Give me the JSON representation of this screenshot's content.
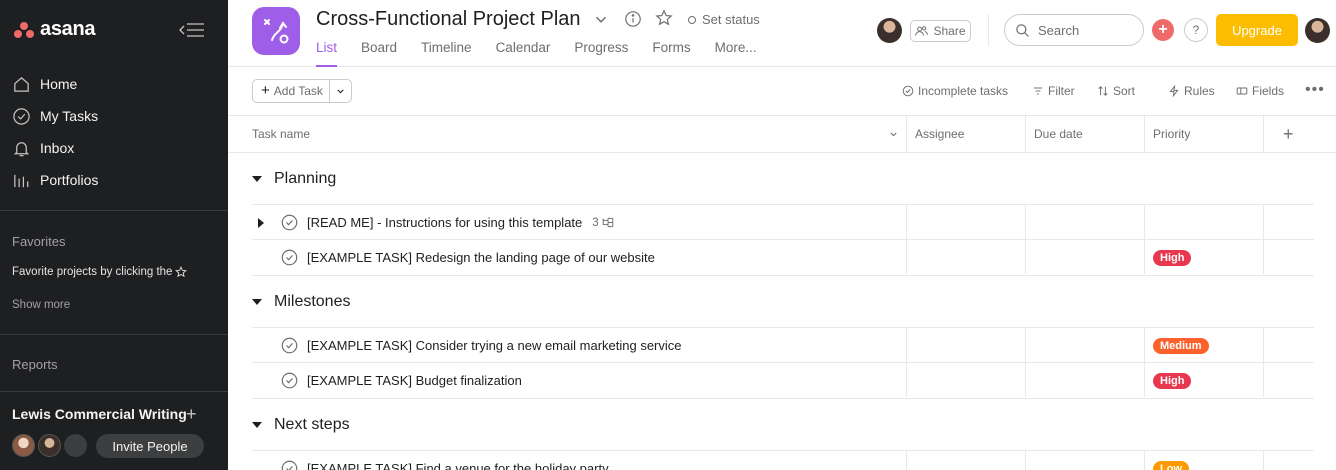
{
  "sidebar": {
    "brand": "asana",
    "nav": [
      {
        "label": "Home",
        "icon": "home-icon"
      },
      {
        "label": "My Tasks",
        "icon": "check-circle-icon"
      },
      {
        "label": "Inbox",
        "icon": "bell-icon"
      },
      {
        "label": "Portfolios",
        "icon": "bar-chart-icon"
      }
    ],
    "favorites_title": "Favorites",
    "favorites_hint": "Favorite projects by clicking the",
    "show_more": "Show more",
    "reports_title": "Reports",
    "team_name": "Lewis Commercial Writing",
    "invite_label": "Invite People"
  },
  "header": {
    "project_title": "Cross-Functional Project Plan",
    "set_status": "Set status",
    "tabs": [
      "List",
      "Board",
      "Timeline",
      "Calendar",
      "Progress",
      "Forms",
      "More..."
    ],
    "active_tab": "List",
    "share_label": "Share",
    "search_placeholder": "Search",
    "help_label": "?",
    "upgrade_label": "Upgrade",
    "accent_color": "#9e5ee8",
    "upgrade_color": "#fcbd01"
  },
  "toolbar": {
    "add_task": "Add Task",
    "incomplete": "Incomplete tasks",
    "filter": "Filter",
    "sort": "Sort",
    "rules": "Rules",
    "fields": "Fields"
  },
  "table": {
    "columns": [
      "Task name",
      "Assignee",
      "Due date",
      "Priority"
    ],
    "sections": [
      {
        "name": "Planning",
        "tasks": [
          {
            "name": "[READ ME] - Instructions for using this template",
            "subtasks": "3",
            "priority": ""
          },
          {
            "name": "[EXAMPLE TASK] Redesign the landing page of our website",
            "priority": "High"
          }
        ]
      },
      {
        "name": "Milestones",
        "tasks": [
          {
            "name": "[EXAMPLE TASK] Consider trying a new email marketing service",
            "priority": "Medium"
          },
          {
            "name": "[EXAMPLE TASK] Budget finalization",
            "priority": "High"
          }
        ]
      },
      {
        "name": "Next steps",
        "tasks": [
          {
            "name": "[EXAMPLE TASK] Find a venue for the holiday party",
            "priority": "Low"
          }
        ]
      }
    ],
    "priority_colors": {
      "High": "#e8384f",
      "Medium": "#fd612c",
      "Low": "#fd9a00"
    }
  }
}
